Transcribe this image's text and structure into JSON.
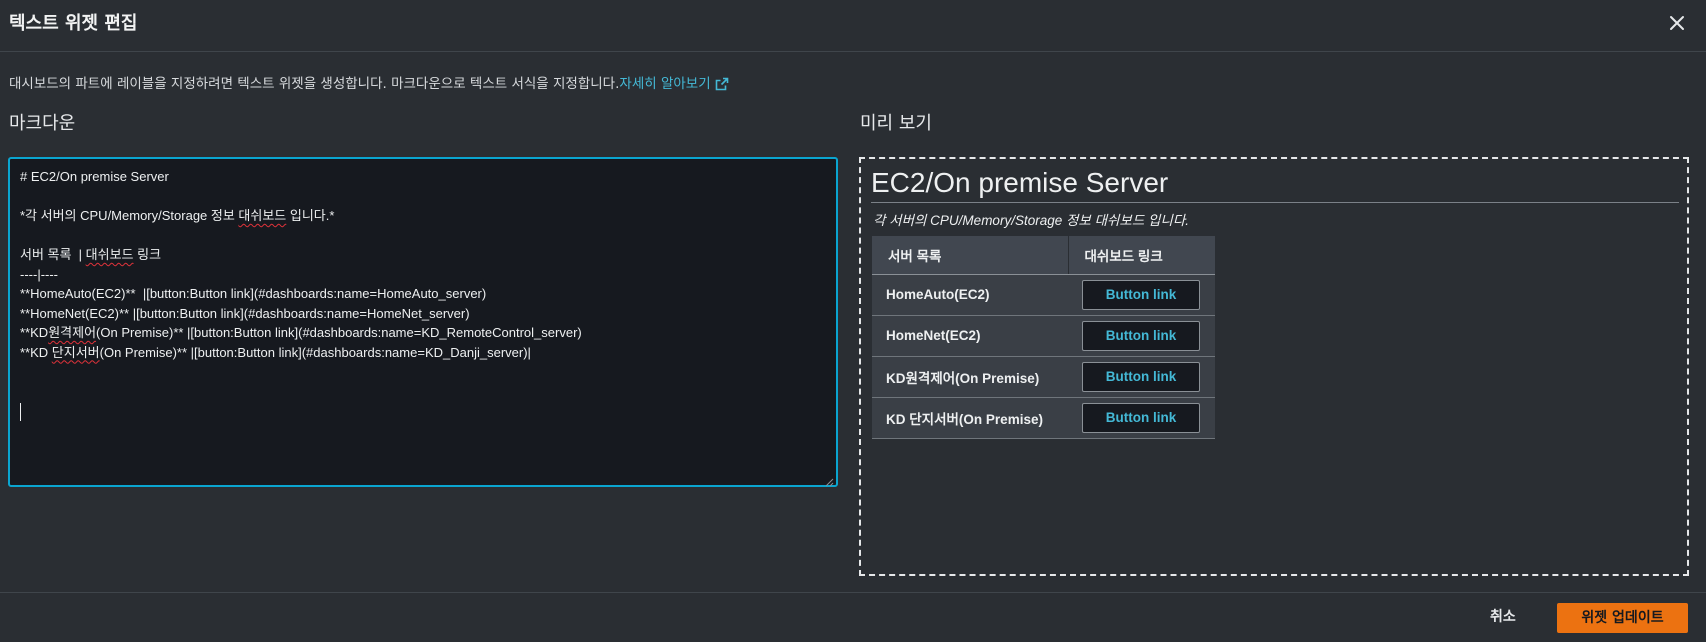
{
  "modal": {
    "title": "텍스트 위젯 편집",
    "description": "대시보드의 파트에 레이블을 지정하려면 텍스트 위젯을 생성합니다. 마크다운으로 텍스트 서식을 지정합니다.",
    "learn_more": "자세히 알아보기"
  },
  "editor": {
    "label": "마크다운",
    "lines": [
      "# EC2/On premise Server",
      "",
      "*각 서버의 CPU/Memory/Storage 정보 대쉬보드 입니다.*",
      "",
      "서버 목록  | 대쉬보드 링크",
      "----|----",
      "**HomeAuto(EC2)**  |[button:Button link](#dashboards:name=HomeAuto_server)",
      "**HomeNet(EC2)** |[button:Button link](#dashboards:name=HomeNet_server)",
      "**KD원격제어(On Premise)** |[button:Button link](#dashboards:name=KD_RemoteControl_server)",
      "**KD 단지서버(On Premise)** |[button:Button link](#dashboards:name=KD_Danji_server)|"
    ]
  },
  "preview": {
    "label": "미리 보기",
    "heading": "EC2/On premise Server",
    "subtitle": "각 서버의 CPU/Memory/Storage 정보 대쉬보드 입니다.",
    "table": {
      "headers": [
        "서버 목록",
        "대쉬보드 링크"
      ],
      "rows": [
        {
          "name": "HomeAuto(EC2)",
          "button": "Button link"
        },
        {
          "name": "HomeNet(EC2)",
          "button": "Button link"
        },
        {
          "name": "KD원격제어(On Premise)",
          "button": "Button link"
        },
        {
          "name": "KD 단지서버(On Premise)",
          "button": "Button link"
        }
      ]
    }
  },
  "footer": {
    "cancel": "취소",
    "update": "위젯 업데이트"
  },
  "icons": {
    "close": "close-icon",
    "external_link": "external-link-icon"
  },
  "colors": {
    "accent": "#ec7211",
    "link": "#44b9d6",
    "focus": "#0aa5d0"
  }
}
